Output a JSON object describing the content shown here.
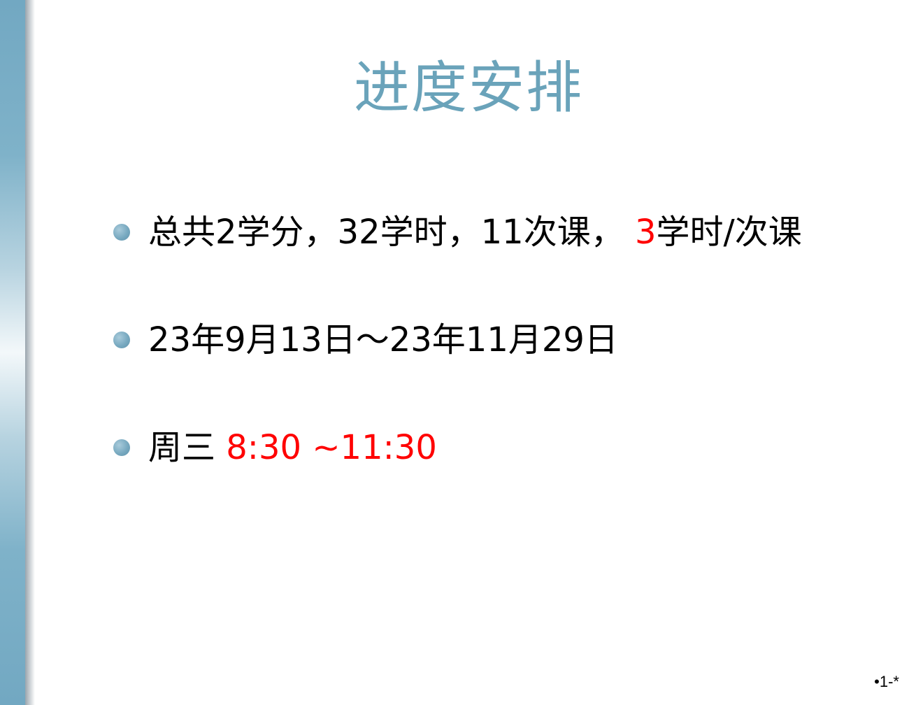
{
  "slide": {
    "title": "进度安排",
    "page_number": "•1-*",
    "accent_color": "#6aa3ba",
    "highlight_color": "#ff0000",
    "bullets": [
      {
        "segments": [
          {
            "text": "总共2学分，32学时，11次课，  "
          },
          {
            "text": "3",
            "highlight": true
          },
          {
            "text": "学时/次课"
          }
        ]
      },
      {
        "segments": [
          {
            "text": "23年9月13日～23年11月29日"
          }
        ]
      },
      {
        "segments": [
          {
            "text": "周三  "
          },
          {
            "text": "8:30 ~11:30",
            "highlight": true
          }
        ]
      }
    ]
  }
}
